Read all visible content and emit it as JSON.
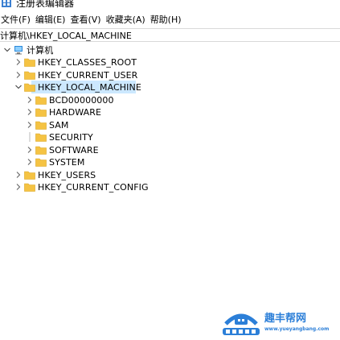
{
  "window": {
    "title": "注册表编辑器"
  },
  "menu": [
    {
      "label": "文件(F)"
    },
    {
      "label": "编辑(E)"
    },
    {
      "label": "查看(V)"
    },
    {
      "label": "收藏夹(A)"
    },
    {
      "label": "帮助(H)"
    }
  ],
  "address": {
    "path": "计算机\\HKEY_LOCAL_MACHINE"
  },
  "tree": {
    "root": {
      "label": "计算机",
      "icon": "computer-icon",
      "expanded": true
    },
    "nodes": [
      {
        "label": "HKEY_CLASSES_ROOT",
        "level": 1,
        "chevron": "right"
      },
      {
        "label": "HKEY_CURRENT_USER",
        "level": 1,
        "chevron": "right"
      },
      {
        "label": "HKEY_LOCAL_MACHINE",
        "level": 1,
        "chevron": "down",
        "selected": true
      },
      {
        "label": "BCD00000000",
        "level": 2,
        "chevron": "right"
      },
      {
        "label": "HARDWARE",
        "level": 2,
        "chevron": "right"
      },
      {
        "label": "SAM",
        "level": 2,
        "chevron": "right"
      },
      {
        "label": "SECURITY",
        "level": 2,
        "chevron": "none"
      },
      {
        "label": "SOFTWARE",
        "level": 2,
        "chevron": "right"
      },
      {
        "label": "SYSTEM",
        "level": 2,
        "chevron": "right"
      },
      {
        "label": "HKEY_USERS",
        "level": 1,
        "chevron": "right"
      },
      {
        "label": "HKEY_CURRENT_CONFIG",
        "level": 1,
        "chevron": "right"
      }
    ]
  },
  "watermark": {
    "title": "趣丰帮网",
    "subtitle": "www.yueyangbang.com"
  },
  "colors": {
    "selection": "#cce8ff",
    "folder": "#f5c343",
    "watermark": "#2c7fd8"
  }
}
